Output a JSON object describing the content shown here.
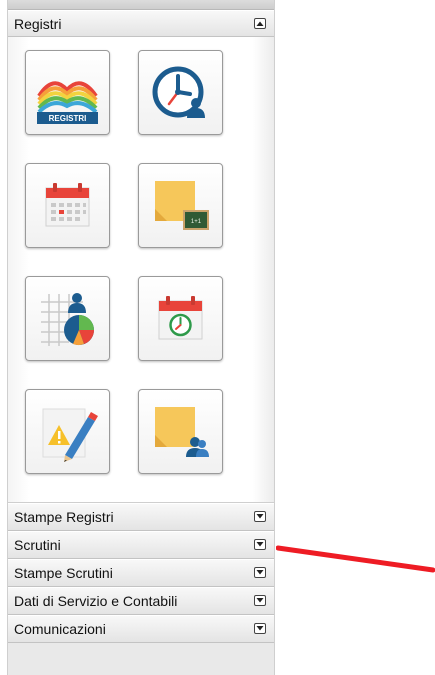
{
  "panels": {
    "registri": {
      "label": "Registri",
      "toggle_icon": "collapse-icon"
    },
    "stampe_registri": {
      "label": "Stampe Registri",
      "toggle_icon": "expand-icon"
    },
    "scrutini": {
      "label": "Scrutini",
      "toggle_icon": "expand-icon"
    },
    "stampe_scrutini": {
      "label": "Stampe Scrutini",
      "toggle_icon": "expand-icon"
    },
    "dati_servizio": {
      "label": "Dati di Servizio e Contabili",
      "toggle_icon": "expand-icon"
    },
    "comunicazioni": {
      "label": "Comunicazioni",
      "toggle_icon": "expand-icon"
    }
  },
  "tiles": [
    {
      "icon": "registri-book-icon",
      "label": "REGISTRI"
    },
    {
      "icon": "clock-user-icon"
    },
    {
      "icon": "calendar-icon"
    },
    {
      "icon": "sticky-note-blackboard-icon"
    },
    {
      "icon": "grid-user-pie-icon"
    },
    {
      "icon": "calendar-clock-icon"
    },
    {
      "icon": "warning-pencil-icon"
    },
    {
      "icon": "sticky-note-users-icon"
    }
  ],
  "colors": {
    "accent_red": "#e8443a",
    "accent_blue": "#1c5c8f",
    "note_yellow": "#f6c75a",
    "arrow_red": "#ee1c24"
  }
}
